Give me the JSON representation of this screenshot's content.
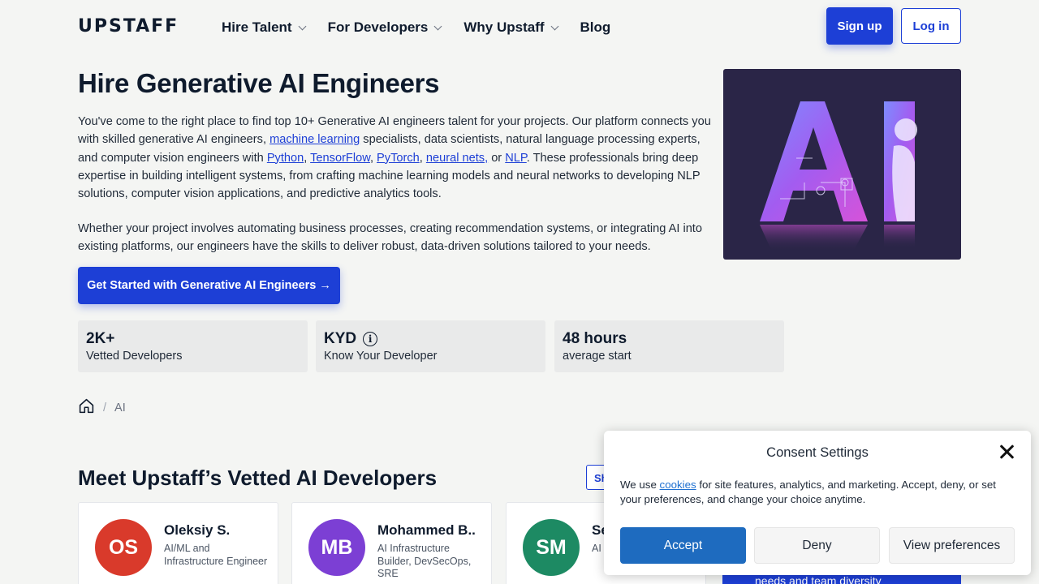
{
  "header": {
    "logo": "UPSTAFF",
    "nav": [
      {
        "label": "Hire Talent",
        "has_dropdown": true
      },
      {
        "label": "For Developers",
        "has_dropdown": true
      },
      {
        "label": "Why Upstaff",
        "has_dropdown": true
      },
      {
        "label": "Blog",
        "has_dropdown": false
      }
    ],
    "signup_label": "Sign up",
    "login_label": "Log in"
  },
  "hero": {
    "title": "Hire Generative AI Engineers",
    "p1_a": "You've come to the right place to find top 10+ Generative AI engineers talent for your projects. Our platform connects you with skilled generative AI engineers, ",
    "link_ml": "machine learning",
    "p1_b": " specialists, data scientists, natural language processing experts, and computer vision engineers with ",
    "link_python": "Python",
    "link_tf": "TensorFlow",
    "link_pytorch": "PyTorch",
    "link_nn": "neural nets,",
    "link_nlp": "NLP",
    "p1_c": ". These professionals bring deep expertise in building intelligent systems, from crafting machine learning models and neural networks to developing NLP solutions, computer vision applications, and predictive analytics tools.",
    "p2": "Whether your project involves automating business processes, creating recommendation systems, or integrating AI into existing platforms, our engineers have the skills to deliver robust, data-driven solutions tailored to your needs.",
    "cta": "Get Started with Generative AI Engineers →",
    "image_text": "AI"
  },
  "stats": [
    {
      "value": "2K+",
      "label": "Vetted Developers",
      "info_icon": false
    },
    {
      "value": "KYD",
      "label": "Know Your Developer",
      "info_icon": true
    },
    {
      "value": "48 hours",
      "label": "average start",
      "info_icon": false
    }
  ],
  "breadcrumb": {
    "separator": "/",
    "current": "AI"
  },
  "section": {
    "title": "Meet Upstaff’s Vetted AI Developers",
    "show_button": "Sh"
  },
  "developers": [
    {
      "initials": "OS",
      "name": "Oleksiy S.",
      "role": "AI/ML and Infrastructure Engineer",
      "color": "#d93a2b"
    },
    {
      "initials": "MB",
      "name": "Mohammed B..",
      "role": "AI Infrastructure Builder, DevSecOps, SRE",
      "color": "#7c3fd4"
    },
    {
      "initials": "SM",
      "name": "Se",
      "role": "AI E",
      "color": "#1d8a63"
    }
  ],
  "blue_card_text": "needs and team diversity",
  "consent": {
    "title": "Consent Settings",
    "text_a": "We use ",
    "link": "cookies",
    "text_b": " for site features, analytics, and marketing. Accept, deny, or set your preferences, and change your choice anytime.",
    "accept": "Accept",
    "deny": "Deny",
    "prefs": "View preferences"
  },
  "colors": {
    "primary": "#1d3fd6",
    "consent_accept": "#1e6bbf",
    "background": "#f4f5f3"
  }
}
